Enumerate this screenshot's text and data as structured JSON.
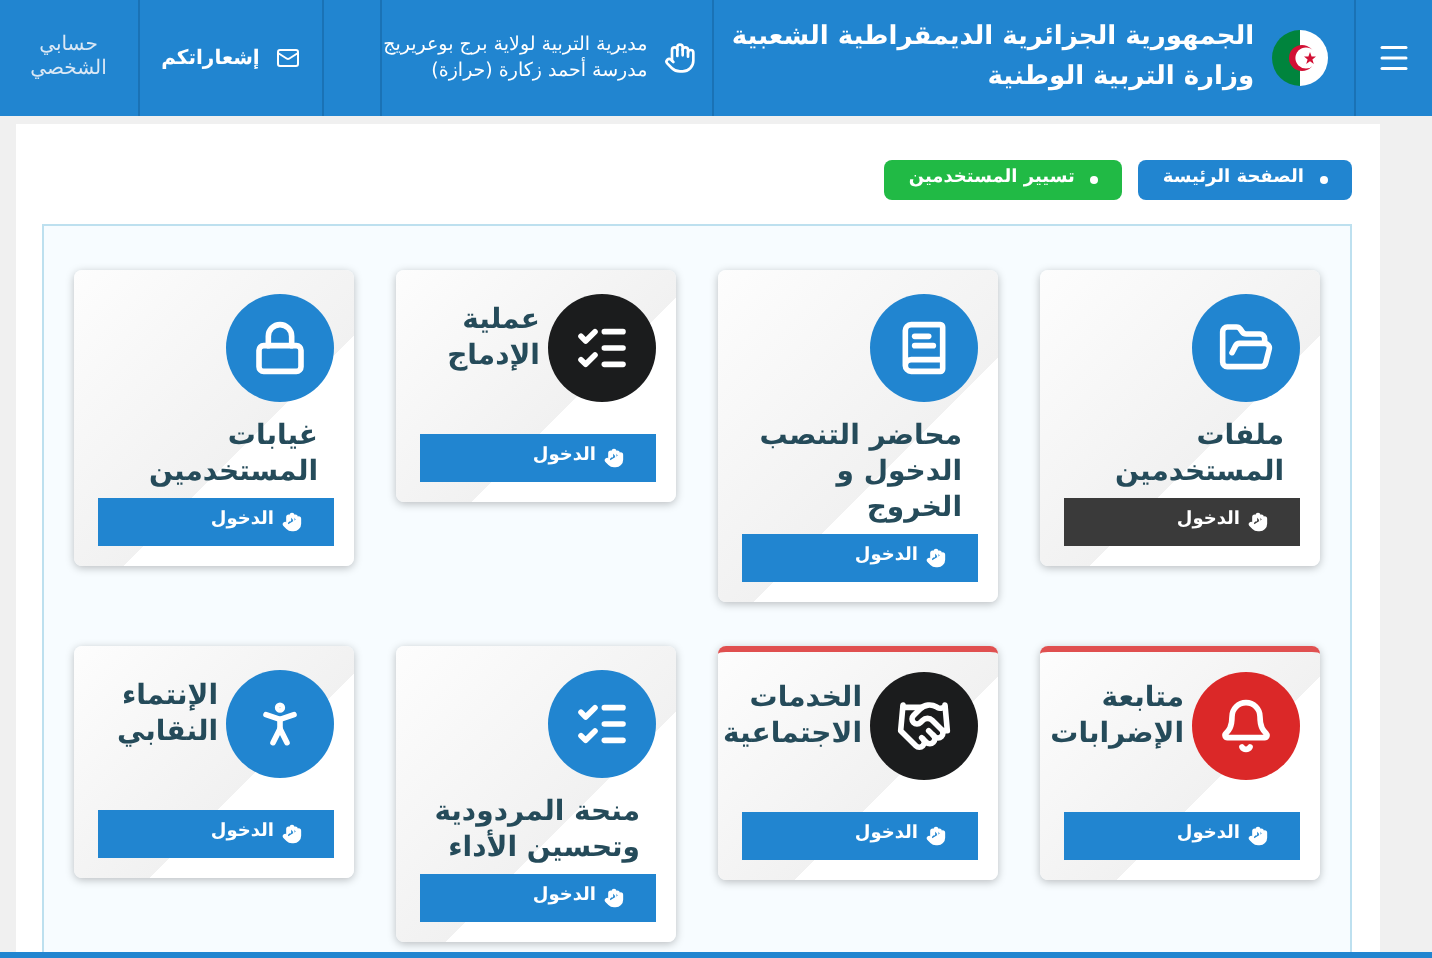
{
  "header": {
    "title_line_1": "الجمهورية الجزائرية الديمقراطية الشعبية",
    "title_line_2": "وزارة التربية الوطنية",
    "directorate": [
      "مديرية التربية لولاية برج بوعريريج",
      "مدرسة أحمد زكارة (حرازة)"
    ],
    "notifications": "إشعاراتكم",
    "account": "حسابي الشخصي"
  },
  "breadcrumb": [
    {
      "label": "الصفحة الرئيسة",
      "color": "#2185d0"
    },
    {
      "label": "تسيير المستخدمين",
      "color": "#21ba45"
    }
  ],
  "cards": [
    {
      "title": "ملفات المستخدمين",
      "kind": "stacked",
      "color": "#2185d0",
      "selected": true,
      "alert": false,
      "button": "الدخول"
    },
    {
      "title": "محاضر التنصب الدخول و الخروج",
      "kind": "stacked",
      "color": "#2185d0",
      "selected": false,
      "alert": false,
      "button": "الدخول"
    },
    {
      "title": "عملية الإدماج",
      "kind": "side",
      "color": "#1b1c1d",
      "selected": false,
      "alert": false,
      "button": "الدخول"
    },
    {
      "title": "غيابات المستخدمين",
      "kind": "stacked",
      "color": "#2185d0",
      "selected": false,
      "alert": false,
      "button": "الدخول"
    },
    {
      "title": "متابعة الإضرابات",
      "kind": "side",
      "color": "#db2828",
      "selected": false,
      "alert": true,
      "button": "الدخول"
    },
    {
      "title": "الخدمات الاجتماعية",
      "kind": "side",
      "color": "#1b1c1d",
      "selected": false,
      "alert": true,
      "button": "الدخول"
    },
    {
      "title": "منحة المردودية وتحسين الأداء",
      "kind": "stacked",
      "color": "#2185d0",
      "selected": false,
      "alert": false,
      "button": "الدخول"
    },
    {
      "title": "الإنتماء النقابي",
      "kind": "side",
      "color": "#2185d0",
      "selected": false,
      "alert": false,
      "button": "الدخول"
    }
  ]
}
